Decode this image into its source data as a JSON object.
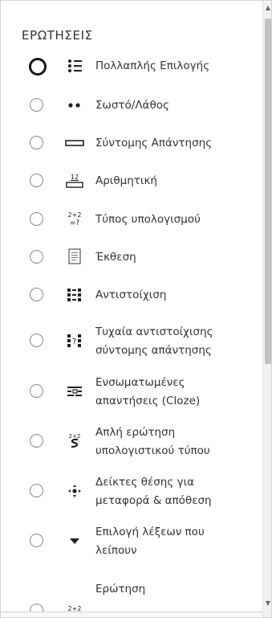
{
  "header": {
    "title": "ΕΡΩΤΗΣΕΙΣ"
  },
  "questions": [
    {
      "icon": "multichoice-icon",
      "label_lines": [
        "Πολλαπλής Επιλογής"
      ],
      "selected": true
    },
    {
      "icon": "truefalse-icon",
      "label_lines": [
        "Σωστό/Λάθος"
      ],
      "selected": false
    },
    {
      "icon": "shortanswer-icon",
      "label_lines": [
        "Σύντομης Απάντησης"
      ],
      "selected": false
    },
    {
      "icon": "numerical-icon",
      "label_lines": [
        "Αριθμητική"
      ],
      "selected": false
    },
    {
      "icon": "calculated-icon",
      "label_lines": [
        "Τύπος υπολογισμού"
      ],
      "selected": false
    },
    {
      "icon": "essay-icon",
      "label_lines": [
        "Έκθεση"
      ],
      "selected": false
    },
    {
      "icon": "matching-icon",
      "label_lines": [
        "Αντιστοίχιση"
      ],
      "selected": false
    },
    {
      "icon": "random-matching-icon",
      "label_lines": [
        "Τυχαία αντιστοίχισης",
        "σύντομης απάντησης"
      ],
      "selected": false
    },
    {
      "icon": "cloze-icon",
      "label_lines": [
        "Ενσωματωμένες",
        "απαντήσεις (Cloze)"
      ],
      "selected": false
    },
    {
      "icon": "calculated-simple-icon",
      "label_lines": [
        "Απλή ερώτηση",
        "υπολογιστικού τύπου"
      ],
      "selected": false
    },
    {
      "icon": "drag-markers-icon",
      "label_lines": [
        "Δείκτες θέσης για",
        "μεταφορά & απόθεση"
      ],
      "selected": false
    },
    {
      "icon": "select-missing-words-icon",
      "label_lines": [
        "Επιλογή λέξεων που",
        "λείπουν"
      ],
      "selected": false
    },
    {
      "icon": "calculated-multi-icon",
      "label_lines": [
        "Ερώτηση"
      ],
      "selected": false
    }
  ]
}
